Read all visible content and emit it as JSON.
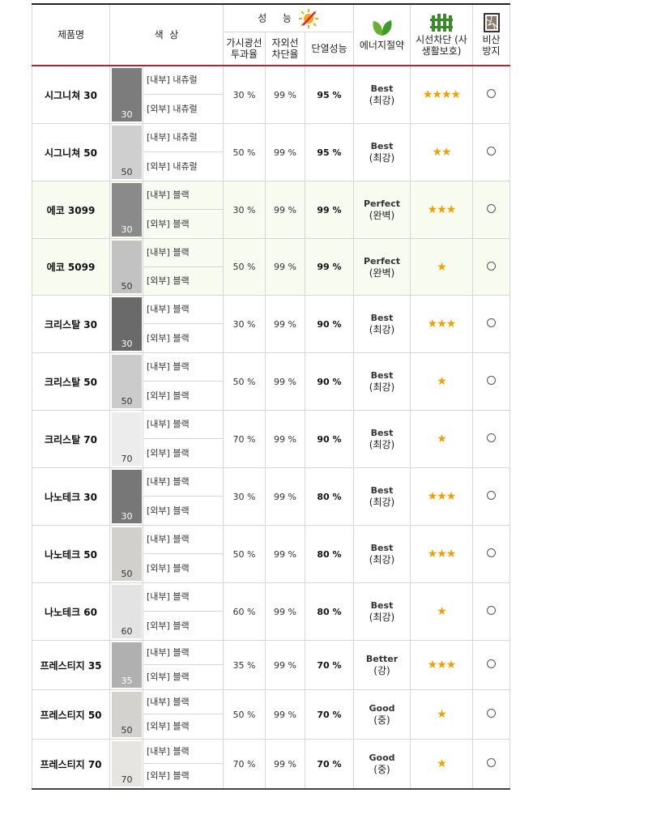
{
  "header": {
    "product": "제품명",
    "color": "색  상",
    "performance": "성  능",
    "visible": "가시광선 투과율",
    "uv": "자외선 차단율",
    "insulation": "단열성능",
    "energy": "에너지절약",
    "privacy": "시선차단 (사생활보호)",
    "shatter": "비산 방지"
  },
  "rows": [
    {
      "name": "시그니쳐 30",
      "shade": "30",
      "swatch": "#7c7c7c",
      "light": false,
      "inner": "[내부] 내츄럴",
      "outer": "[외부] 내츄럴",
      "visible": "30 %",
      "uv": "99 %",
      "insulation": "95 %",
      "grade_en": "Best",
      "grade_ko": "(최강)",
      "stars": "★★★★",
      "shatter": "○",
      "eco": false
    },
    {
      "name": "시그니쳐 50",
      "shade": "50",
      "swatch": "#cfcfcf",
      "light": true,
      "inner": "[내부] 내츄럴",
      "outer": "[외부] 내츄럴",
      "visible": "50 %",
      "uv": "99 %",
      "insulation": "95 %",
      "grade_en": "Best",
      "grade_ko": "(최강)",
      "stars": "★★",
      "shatter": "○",
      "eco": false
    },
    {
      "name": "에코 3099",
      "shade": "30",
      "swatch": "#8a8a8a",
      "light": false,
      "inner": "[내부] 블랙",
      "outer": "[외부] 블랙",
      "visible": "30 %",
      "uv": "99 %",
      "insulation": "99 %",
      "grade_en": "Perfect",
      "grade_ko": "(완벽)",
      "stars": "★★★",
      "shatter": "○",
      "eco": true
    },
    {
      "name": "에코 5099",
      "shade": "50",
      "swatch": "#c2c2c2",
      "light": true,
      "inner": "[내부] 블랙",
      "outer": "[외부] 블랙",
      "visible": "50 %",
      "uv": "99 %",
      "insulation": "99 %",
      "grade_en": "Perfect",
      "grade_ko": "(완벽)",
      "stars": "★",
      "shatter": "○",
      "eco": true
    },
    {
      "name": "크리스탈 30",
      "shade": "30",
      "swatch": "#6a6a6a",
      "light": false,
      "inner": "[내부] 블랙",
      "outer": "[외부] 블랙",
      "visible": "30 %",
      "uv": "99 %",
      "insulation": "90 %",
      "grade_en": "Best",
      "grade_ko": "(최강)",
      "stars": "★★★",
      "shatter": "○",
      "eco": false
    },
    {
      "name": "크리스탈 50",
      "shade": "50",
      "swatch": "#cbcbcb",
      "light": true,
      "inner": "[내부] 블랙",
      "outer": "[외부] 블랙",
      "visible": "50 %",
      "uv": "99 %",
      "insulation": "90 %",
      "grade_en": "Best",
      "grade_ko": "(최강)",
      "stars": "★",
      "shatter": "○",
      "eco": false
    },
    {
      "name": "크리스탈 70",
      "shade": "70",
      "swatch": "#ececec",
      "light": true,
      "inner": "[내부] 블랙",
      "outer": "[외부] 블랙",
      "visible": "70 %",
      "uv": "99 %",
      "insulation": "90 %",
      "grade_en": "Best",
      "grade_ko": "(최강)",
      "stars": "★",
      "shatter": "○",
      "eco": false
    },
    {
      "name": "나노테크 30",
      "shade": "30",
      "swatch": "#777777",
      "light": false,
      "inner": "[내부] 블랙",
      "outer": "[외부] 블랙",
      "visible": "30 %",
      "uv": "99 %",
      "insulation": "80 %",
      "grade_en": "Best",
      "grade_ko": "(최강)",
      "stars": "★★★",
      "shatter": "○",
      "eco": false
    },
    {
      "name": "나노테크 50",
      "shade": "50",
      "swatch": "#d2d0cc",
      "light": true,
      "inner": "[내부] 블랙",
      "outer": "[외부] 블랙",
      "visible": "50 %",
      "uv": "99 %",
      "insulation": "80 %",
      "grade_en": "Best",
      "grade_ko": "(최강)",
      "stars": "★★★",
      "shatter": "○",
      "eco": false
    },
    {
      "name": "나노테크 60",
      "shade": "60",
      "swatch": "#e3e3e3",
      "light": true,
      "inner": "[내부] 블랙",
      "outer": "[외부] 블랙",
      "visible": "60 %",
      "uv": "99 %",
      "insulation": "80 %",
      "grade_en": "Best",
      "grade_ko": "(최강)",
      "stars": "★",
      "shatter": "○",
      "eco": false
    },
    {
      "name": "프레스티지 35",
      "shade": "35",
      "swatch": "#b0b0b0",
      "light": false,
      "inner": "[내부] 블랙",
      "outer": "[외부] 블랙",
      "visible": "35 %",
      "uv": "99 %",
      "insulation": "70 %",
      "grade_en": "Better",
      "grade_ko": "(강)",
      "stars": "★★★",
      "shatter": "○",
      "eco": false
    },
    {
      "name": "프레스티지 50",
      "shade": "50",
      "swatch": "#d4d2ce",
      "light": true,
      "inner": "[내부] 블랙",
      "outer": "[외부] 블랙",
      "visible": "50 %",
      "uv": "99 %",
      "insulation": "70 %",
      "grade_en": "Good",
      "grade_ko": "(중)",
      "stars": "★",
      "shatter": "○",
      "eco": false
    },
    {
      "name": "프레스티지 70",
      "shade": "70",
      "swatch": "#e6e5e1",
      "light": true,
      "inner": "[내부] 블랙",
      "outer": "[외부] 블랙",
      "visible": "70 %",
      "uv": "99 %",
      "insulation": "70 %",
      "grade_en": "Good",
      "grade_ko": "(중)",
      "stars": "★",
      "shatter": "○",
      "eco": false
    }
  ]
}
